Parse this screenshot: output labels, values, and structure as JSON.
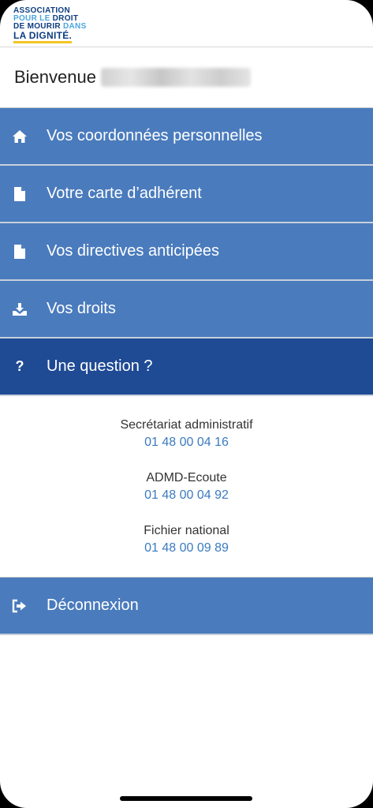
{
  "logo": {
    "line1": "ASSOCIATION",
    "line2a": "POUR LE",
    "line2b": "DROIT",
    "line3a": "DE MOURIR",
    "line3b": "DANS",
    "line4": "LA DIGNITÉ."
  },
  "welcome": {
    "label": "Bienvenue"
  },
  "menu": [
    {
      "label": "Vos coordonnées personnelles",
      "icon": "home-icon"
    },
    {
      "label": "Votre carte d’adhérent",
      "icon": "file-icon"
    },
    {
      "label": "Vos directives anticipées",
      "icon": "file-icon"
    },
    {
      "label": "Vos droits",
      "icon": "download-icon"
    },
    {
      "label": "Une question ?",
      "icon": "question-icon"
    }
  ],
  "contacts": [
    {
      "title": "Secrétariat administratif",
      "phone": "01 48 00 04 16"
    },
    {
      "title": "ADMD-Ecoute",
      "phone": "01 48 00 04 92"
    },
    {
      "title": "Fichier national",
      "phone": "01 48 00 09 89"
    }
  ],
  "logout": {
    "label": "Déconnexion",
    "icon": "logout-icon"
  },
  "colors": {
    "menu": "#4a7bbd",
    "menu_active": "#1f4a94",
    "link": "#3a7bc0"
  }
}
